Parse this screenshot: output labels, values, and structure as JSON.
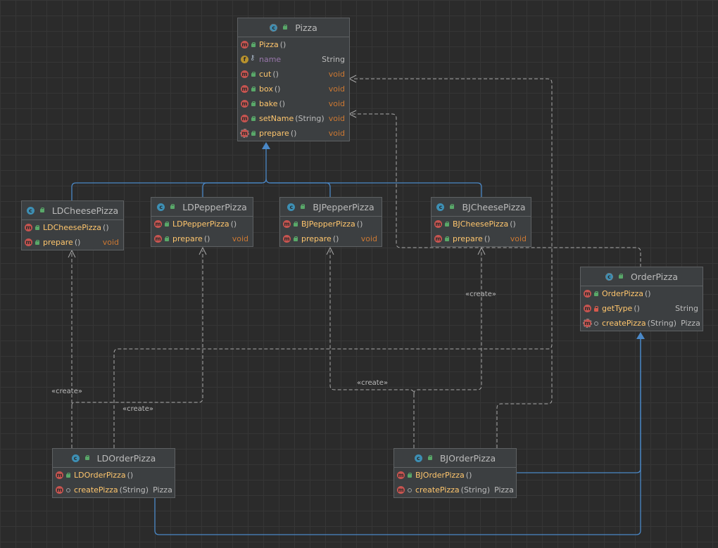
{
  "colors": {
    "background": "#2b2b2b",
    "method_name": "#ffc66d",
    "field_name": "#9876aa",
    "void_type": "#cc7832",
    "inheritance_line": "#4a88c7",
    "dependency_line": "#a9a9a9"
  },
  "classes": {
    "pizza": {
      "name": "Pizza",
      "icon": "abstract-class-icon",
      "members": [
        {
          "icon": "method-icon",
          "vis": "public",
          "name": "Pizza",
          "args": "()",
          "type": ""
        },
        {
          "icon": "field-icon",
          "vis": "key",
          "name": "name",
          "args": "",
          "type": "String",
          "field": true
        },
        {
          "icon": "method-icon",
          "vis": "public",
          "name": "cut",
          "args": "()",
          "type": "void"
        },
        {
          "icon": "method-icon",
          "vis": "public",
          "name": "box",
          "args": "()",
          "type": "void"
        },
        {
          "icon": "method-icon",
          "vis": "public",
          "name": "bake",
          "args": "()",
          "type": "void"
        },
        {
          "icon": "method-icon",
          "vis": "public",
          "name": "setName",
          "args": "(String)",
          "type": "void"
        },
        {
          "icon": "abstract-method-icon",
          "vis": "public",
          "name": "prepare",
          "args": "()",
          "type": "void"
        }
      ]
    },
    "ldcheese": {
      "name": "LDCheesePizza",
      "icon": "class-icon",
      "members": [
        {
          "icon": "method-icon",
          "vis": "public",
          "name": "LDCheesePizza",
          "args": "()",
          "type": ""
        },
        {
          "icon": "method-icon",
          "vis": "public",
          "name": "prepare",
          "args": "()",
          "type": "void"
        }
      ]
    },
    "ldpepper": {
      "name": "LDPepperPizza",
      "icon": "class-icon",
      "members": [
        {
          "icon": "method-icon",
          "vis": "public",
          "name": "LDPepperPizza",
          "args": "()",
          "type": ""
        },
        {
          "icon": "method-icon",
          "vis": "public",
          "name": "prepare",
          "args": "()",
          "type": "void"
        }
      ]
    },
    "bjpepper": {
      "name": "BJPepperPizza",
      "icon": "class-icon",
      "members": [
        {
          "icon": "method-icon",
          "vis": "public",
          "name": "BJPepperPizza",
          "args": "()",
          "type": ""
        },
        {
          "icon": "method-icon",
          "vis": "public",
          "name": "prepare",
          "args": "()",
          "type": "void"
        }
      ]
    },
    "bjcheese": {
      "name": "BJCheesePizza",
      "icon": "class-icon",
      "members": [
        {
          "icon": "method-icon",
          "vis": "public",
          "name": "BJCheesePizza",
          "args": "()",
          "type": ""
        },
        {
          "icon": "method-icon",
          "vis": "public",
          "name": "prepare",
          "args": "()",
          "type": "void"
        }
      ]
    },
    "orderpizza": {
      "name": "OrderPizza",
      "icon": "abstract-class-icon",
      "members": [
        {
          "icon": "method-icon",
          "vis": "public",
          "name": "OrderPizza",
          "args": "()",
          "type": ""
        },
        {
          "icon": "method-icon",
          "vis": "private",
          "name": "getType",
          "args": "()",
          "type": "String"
        },
        {
          "icon": "abstract-method-icon",
          "vis": "package",
          "name": "createPizza",
          "args": "(String)",
          "type": "Pizza"
        }
      ]
    },
    "ldorder": {
      "name": "LDOrderPizza",
      "icon": "class-icon",
      "members": [
        {
          "icon": "method-icon",
          "vis": "public",
          "name": "LDOrderPizza",
          "args": "()",
          "type": ""
        },
        {
          "icon": "method-icon",
          "vis": "package",
          "name": "createPizza",
          "args": "(String)",
          "type": "Pizza"
        }
      ]
    },
    "bjorder": {
      "name": "BJOrderPizza",
      "icon": "class-icon",
      "members": [
        {
          "icon": "method-icon",
          "vis": "public",
          "name": "BJOrderPizza",
          "args": "()",
          "type": ""
        },
        {
          "icon": "method-icon",
          "vis": "package",
          "name": "createPizza",
          "args": "(String)",
          "type": "Pizza"
        }
      ]
    }
  },
  "edge_labels": {
    "create_1": "«create»",
    "create_2": "«create»",
    "create_3": "«create»",
    "create_4": "«create»"
  }
}
